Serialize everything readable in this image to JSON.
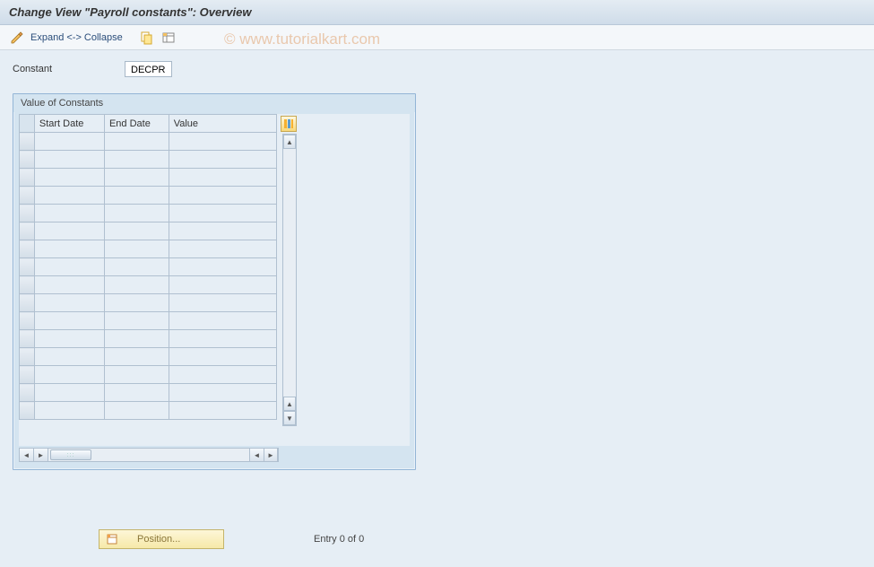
{
  "header": {
    "title": "Change View \"Payroll constants\": Overview"
  },
  "toolbar": {
    "expand_collapse": "Expand <-> Collapse"
  },
  "watermark": "© www.tutorialkart.com",
  "field": {
    "label": "Constant",
    "value": "DECPR"
  },
  "panel": {
    "title": "Value of Constants",
    "columns": {
      "start": "Start Date",
      "end": "End Date",
      "value": "Value"
    },
    "rows": [
      "",
      "",
      "",
      "",
      "",
      "",
      "",
      "",
      "",
      "",
      "",
      "",
      "",
      "",
      "",
      ""
    ]
  },
  "footer": {
    "position_btn": "Position...",
    "entry_text": "Entry 0 of 0"
  }
}
